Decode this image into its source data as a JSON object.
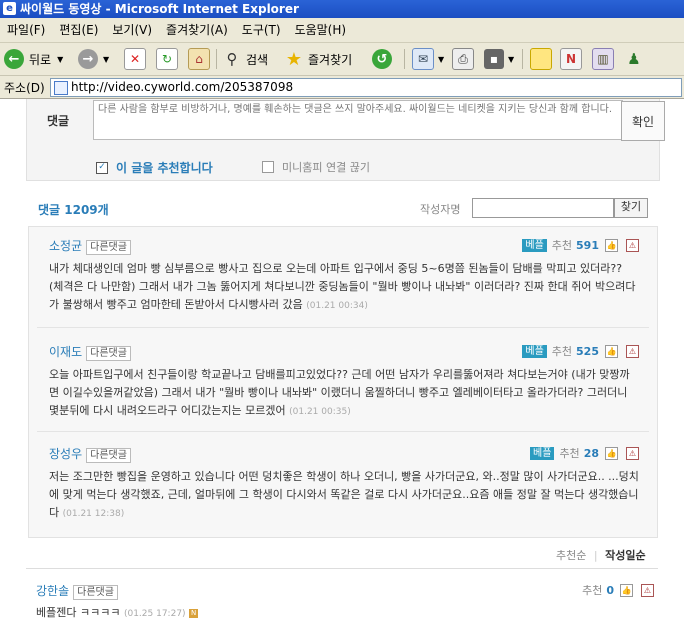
{
  "window": {
    "title": "싸이월드 동영상 - Microsoft Internet Explorer"
  },
  "menu": [
    "파일(F)",
    "편집(E)",
    "보기(V)",
    "즐겨찾기(A)",
    "도구(T)",
    "도움말(H)"
  ],
  "toolbar": {
    "back_label": "뒤로",
    "search_label": "검색",
    "favorites_label": "즐겨찾기"
  },
  "address": {
    "label": "주소(D)",
    "url": "http://video.cyworld.com/205387098"
  },
  "form": {
    "label": "댓글",
    "placeholder": "다른 사람을 함부로 비방하거나, 명예를 훼손하는 댓글은 쓰지 말아주세요. 싸이월드는 네티켓을 지키는 당신과 함께 합니다.",
    "confirm": "확인",
    "recommend": "이 글을 추천합니다",
    "minihompy": "미니홈피 연결 끊기"
  },
  "comment_count": "댓글 1209개",
  "search": {
    "label": "작성자명",
    "button": "찾기"
  },
  "labels": {
    "reply": "다른댓글",
    "best": "베플",
    "recommend": "추천"
  },
  "comments": [
    {
      "author": "소정균",
      "recommends": "591",
      "text": "내가 체대생인데 엄마 빵 심부름으로 빵사고 집으로 오는데 아파트 입구에서 중딩 5~6명쯤 된놈들이 담배를 막피고 있더라?? (체격은 다 나만함) 그래서 내가 그놈 뚫어지게 쳐다보니깐 중딩놈들이 \"뭘바 빵이나 내놔봐\" 이러더라? 진짜 한대 쥐어 박으려다가 불쌍해서 빵주고 엄마한테 돈받아서 다시빵사러 갔음",
      "time": "(01.21 00:34)"
    },
    {
      "author": "이재도",
      "recommends": "525",
      "text": "오늘 아파트입구에서 친구들이랑 학교끝나고 담배를피고있었다?? 근데 어떤 남자가 우리를뚫어져라 쳐다보는거야 (내가 맞짱까면 이길수있을꺼같았음) 그래서 내가 \"뭘바 빵이나 내놔봐\" 이랬더니 움찔하더니 빵주고 엘레베이터타고 올라가더라? 그러더니 몇분뒤에 다시 내려오드라구 어디갔는지는 모르겠어",
      "time": "(01.21 00:35)"
    },
    {
      "author": "장성우",
      "recommends": "28",
      "text": "저는 조그만한 빵집을 운영하고 있습니다 어떤 덩치좋은 학생이 하나 오더니, 빵을 사가더군요, 와..정말 많이 사가더군요.. ...덩치에 맞게 먹는다 생각했죠, 근데, 얼마뒤에 그 학생이 다시와서 똑같은 걸로 다시 사가더군요..요즘 애들 정말 잘 먹는다 생각했습니다",
      "time": "(01.21 12:38)"
    }
  ],
  "sort": {
    "by_recommend": "추천순",
    "by_date": "작성일순"
  },
  "latest_comment": {
    "author": "강한솔",
    "recommends": "0",
    "text": "베플젠다 ㅋㅋㅋㅋ",
    "time": "(01.25 17:27)"
  },
  "colors": {
    "accent": "#2a7db8",
    "best_badge": "#2a9bc0",
    "titlebar": "#1b4ec2"
  }
}
